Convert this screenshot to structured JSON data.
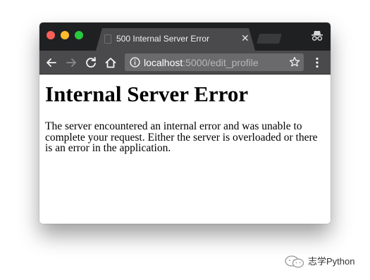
{
  "browser": {
    "tab": {
      "title": "500 Internal Server Error"
    },
    "address_bar": {
      "host": "localhost",
      "path": ":5000/edit_profile"
    },
    "icons": {
      "back": "back-arrow-icon",
      "forward": "forward-arrow-icon",
      "reload": "reload-icon",
      "home": "home-icon",
      "info": "info-icon",
      "bookmark": "star-icon",
      "menu": "kebab-menu-icon",
      "incognito": "incognito-icon",
      "tab_close": "close-icon"
    },
    "colors": {
      "titlebar": "#1f2022",
      "toolbar": "#4a4a4c",
      "omnibox": "#6a6a6d",
      "close_dot": "#fc5f57",
      "minimize_dot": "#fdbc2e",
      "zoom_dot": "#28c840"
    }
  },
  "page": {
    "heading": "Internal Server Error",
    "message": "The server encountered an internal error and was unable to complete your request. Either the server is overloaded or there is an error in the application."
  },
  "watermark": {
    "text": "志学Python"
  }
}
